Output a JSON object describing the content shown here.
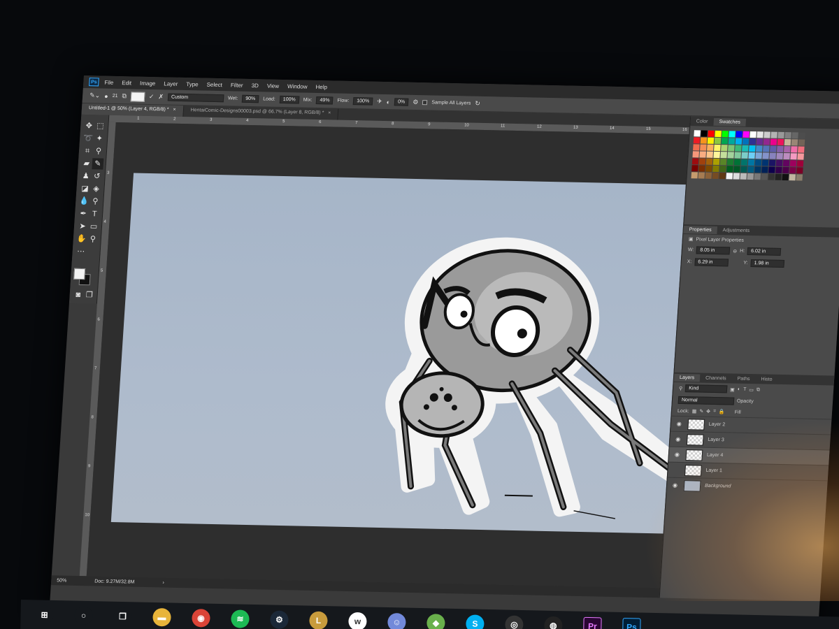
{
  "menubar": {
    "logo": "Ps",
    "items": [
      "File",
      "Edit",
      "Image",
      "Layer",
      "Type",
      "Select",
      "Filter",
      "3D",
      "View",
      "Window",
      "Help"
    ]
  },
  "options": {
    "brush_size": "21",
    "preset": "Custom",
    "wet_label": "Wet:",
    "wet_value": "90%",
    "load_label": "Load:",
    "load_value": "100%",
    "mix_label": "Mix:",
    "mix_value": "49%",
    "flow_label": "Flow:",
    "flow_value": "100%",
    "angle_value": "0%",
    "sample_all_layers": "Sample All Layers"
  },
  "tabs": [
    {
      "label": "Untitled-1 @ 50% (Layer 4, RGB/8) *",
      "active": true
    },
    {
      "label": "HentaiComic-Designs00003.psd @ 66.7% (Layer 8, RGB/8) *",
      "active": false
    }
  ],
  "ruler": {
    "top": [
      "1",
      "2",
      "3",
      "4",
      "5",
      "6",
      "7",
      "8",
      "9",
      "10",
      "11",
      "12",
      "13",
      "14",
      "15",
      "16"
    ],
    "left": [
      "3",
      "4",
      "5",
      "6",
      "7",
      "8",
      "9",
      "10"
    ]
  },
  "status": {
    "zoom": "50%",
    "doc": "Doc: 9.27M/32.8M",
    "arrow": "›"
  },
  "panels": {
    "color_tabs": [
      "Color",
      "Swatches"
    ],
    "properties_tabs": [
      "Properties",
      "Adjustments"
    ],
    "pixel_layer_title": "Pixel Layer Properties",
    "w_label": "W:",
    "w_value": "8.05 in",
    "h_label": "H:",
    "h_value": "6.02 in",
    "x_label": "X:",
    "x_value": "6.29 in",
    "y_label": "Y:",
    "y_value": "1.98 in",
    "layers_tabs": [
      "Layers",
      "Channels",
      "Paths",
      "Histo"
    ],
    "kind_label": "Kind",
    "blend_mode": "Normal",
    "opacity_label": "Opacity",
    "lock_label": "Lock:",
    "fill_label": "Fill",
    "layers": [
      {
        "name": "Layer 2",
        "visible": true,
        "selected": false
      },
      {
        "name": "Layer 3",
        "visible": true,
        "selected": false
      },
      {
        "name": "Layer 4",
        "visible": true,
        "selected": true
      },
      {
        "name": "Layer 1",
        "visible": false,
        "selected": false
      },
      {
        "name": "Background",
        "visible": true,
        "selected": false
      }
    ]
  },
  "swatch_colors": [
    "#ffffff",
    "#000000",
    "#ff0000",
    "#ffff00",
    "#00ff00",
    "#00ffff",
    "#0000ff",
    "#ff00ff",
    "#ffffff",
    "#e6e6e6",
    "#cccccc",
    "#b3b3b3",
    "#999999",
    "#808080",
    "#666666",
    "#4d4d4d",
    "#ed1c24",
    "#f7941d",
    "#fff200",
    "#8dc63f",
    "#00a651",
    "#00a99d",
    "#00aeef",
    "#0072bc",
    "#2e3192",
    "#662d91",
    "#92278f",
    "#ec008c",
    "#ed145b",
    "#c7b299",
    "#998675",
    "#736357",
    "#f26c4f",
    "#f68e55",
    "#fbaf5c",
    "#fff467",
    "#acd372",
    "#7cc576",
    "#3bb878",
    "#1abbb4",
    "#00bff3",
    "#438cca",
    "#5574b9",
    "#605ca8",
    "#855fa8",
    "#a763a8",
    "#f06ea9",
    "#f26d7d",
    "#f7977a",
    "#f9ad81",
    "#fdc68a",
    "#fff79a",
    "#c4df9b",
    "#a3d39c",
    "#82ca9d",
    "#7bcdc8",
    "#6ecff6",
    "#7ea7d8",
    "#8493ca",
    "#8882be",
    "#a187be",
    "#bc8cbf",
    "#f49ac2",
    "#f6989d",
    "#9e0b0f",
    "#a0410d",
    "#a3620a",
    "#aba000",
    "#598527",
    "#1a7b30",
    "#007236",
    "#00746b",
    "#0076a3",
    "#004b80",
    "#003471",
    "#1b1464",
    "#440e62",
    "#630460",
    "#9e005d",
    "#9e0039",
    "#790000",
    "#7b2e00",
    "#7d4900",
    "#827b00",
    "#406618",
    "#005e20",
    "#005826",
    "#005952",
    "#005b7f",
    "#003663",
    "#002157",
    "#0d004c",
    "#32004b",
    "#4b0049",
    "#7b0046",
    "#7a0026",
    "#c69c6d",
    "#a67c52",
    "#8c6239",
    "#754c24",
    "#603913",
    "#f5f5f5",
    "#dddddd",
    "#bbbbbb",
    "#999999",
    "#777777",
    "#555555",
    "#333333",
    "#222222",
    "#111111",
    "#c2b5a0",
    "#8a7d6b"
  ],
  "taskbar": [
    {
      "icon": "windows-start-icon",
      "glyph": "⊞",
      "color": "#15181c"
    },
    {
      "icon": "cortana-icon",
      "glyph": "○",
      "color": "#15181c"
    },
    {
      "icon": "task-view-icon",
      "glyph": "❐",
      "color": "#15181c"
    },
    {
      "icon": "file-explorer-icon",
      "glyph": "▬",
      "color": "#e8b43a"
    },
    {
      "icon": "chrome-icon",
      "glyph": "◉",
      "color": "#db4437"
    },
    {
      "icon": "spotify-icon",
      "glyph": "≋",
      "color": "#1db954"
    },
    {
      "icon": "steam-icon",
      "glyph": "⚙",
      "color": "#1b2838"
    },
    {
      "icon": "league-icon",
      "glyph": "L",
      "color": "#c89b3c"
    },
    {
      "icon": "wacom-icon",
      "glyph": "w",
      "color": "#ffffff"
    },
    {
      "icon": "discord-icon",
      "glyph": "☺",
      "color": "#7289da"
    },
    {
      "icon": "game-icon",
      "glyph": "◆",
      "color": "#6ab04c"
    },
    {
      "icon": "skype-icon",
      "glyph": "S",
      "color": "#00aff0"
    },
    {
      "icon": "app-icon",
      "glyph": "◎",
      "color": "#333333"
    },
    {
      "icon": "obs-icon",
      "glyph": "◍",
      "color": "#222222"
    },
    {
      "icon": "premiere-icon",
      "glyph": "Pr",
      "color": "#2a0634"
    },
    {
      "icon": "photoshop-icon",
      "glyph": "Ps",
      "color": "#001e36"
    }
  ],
  "accent": {
    "photoshop_blue": "#31a8ff",
    "premiere_purple": "#e77bff",
    "canvas_bg": "#a9b6c7"
  }
}
